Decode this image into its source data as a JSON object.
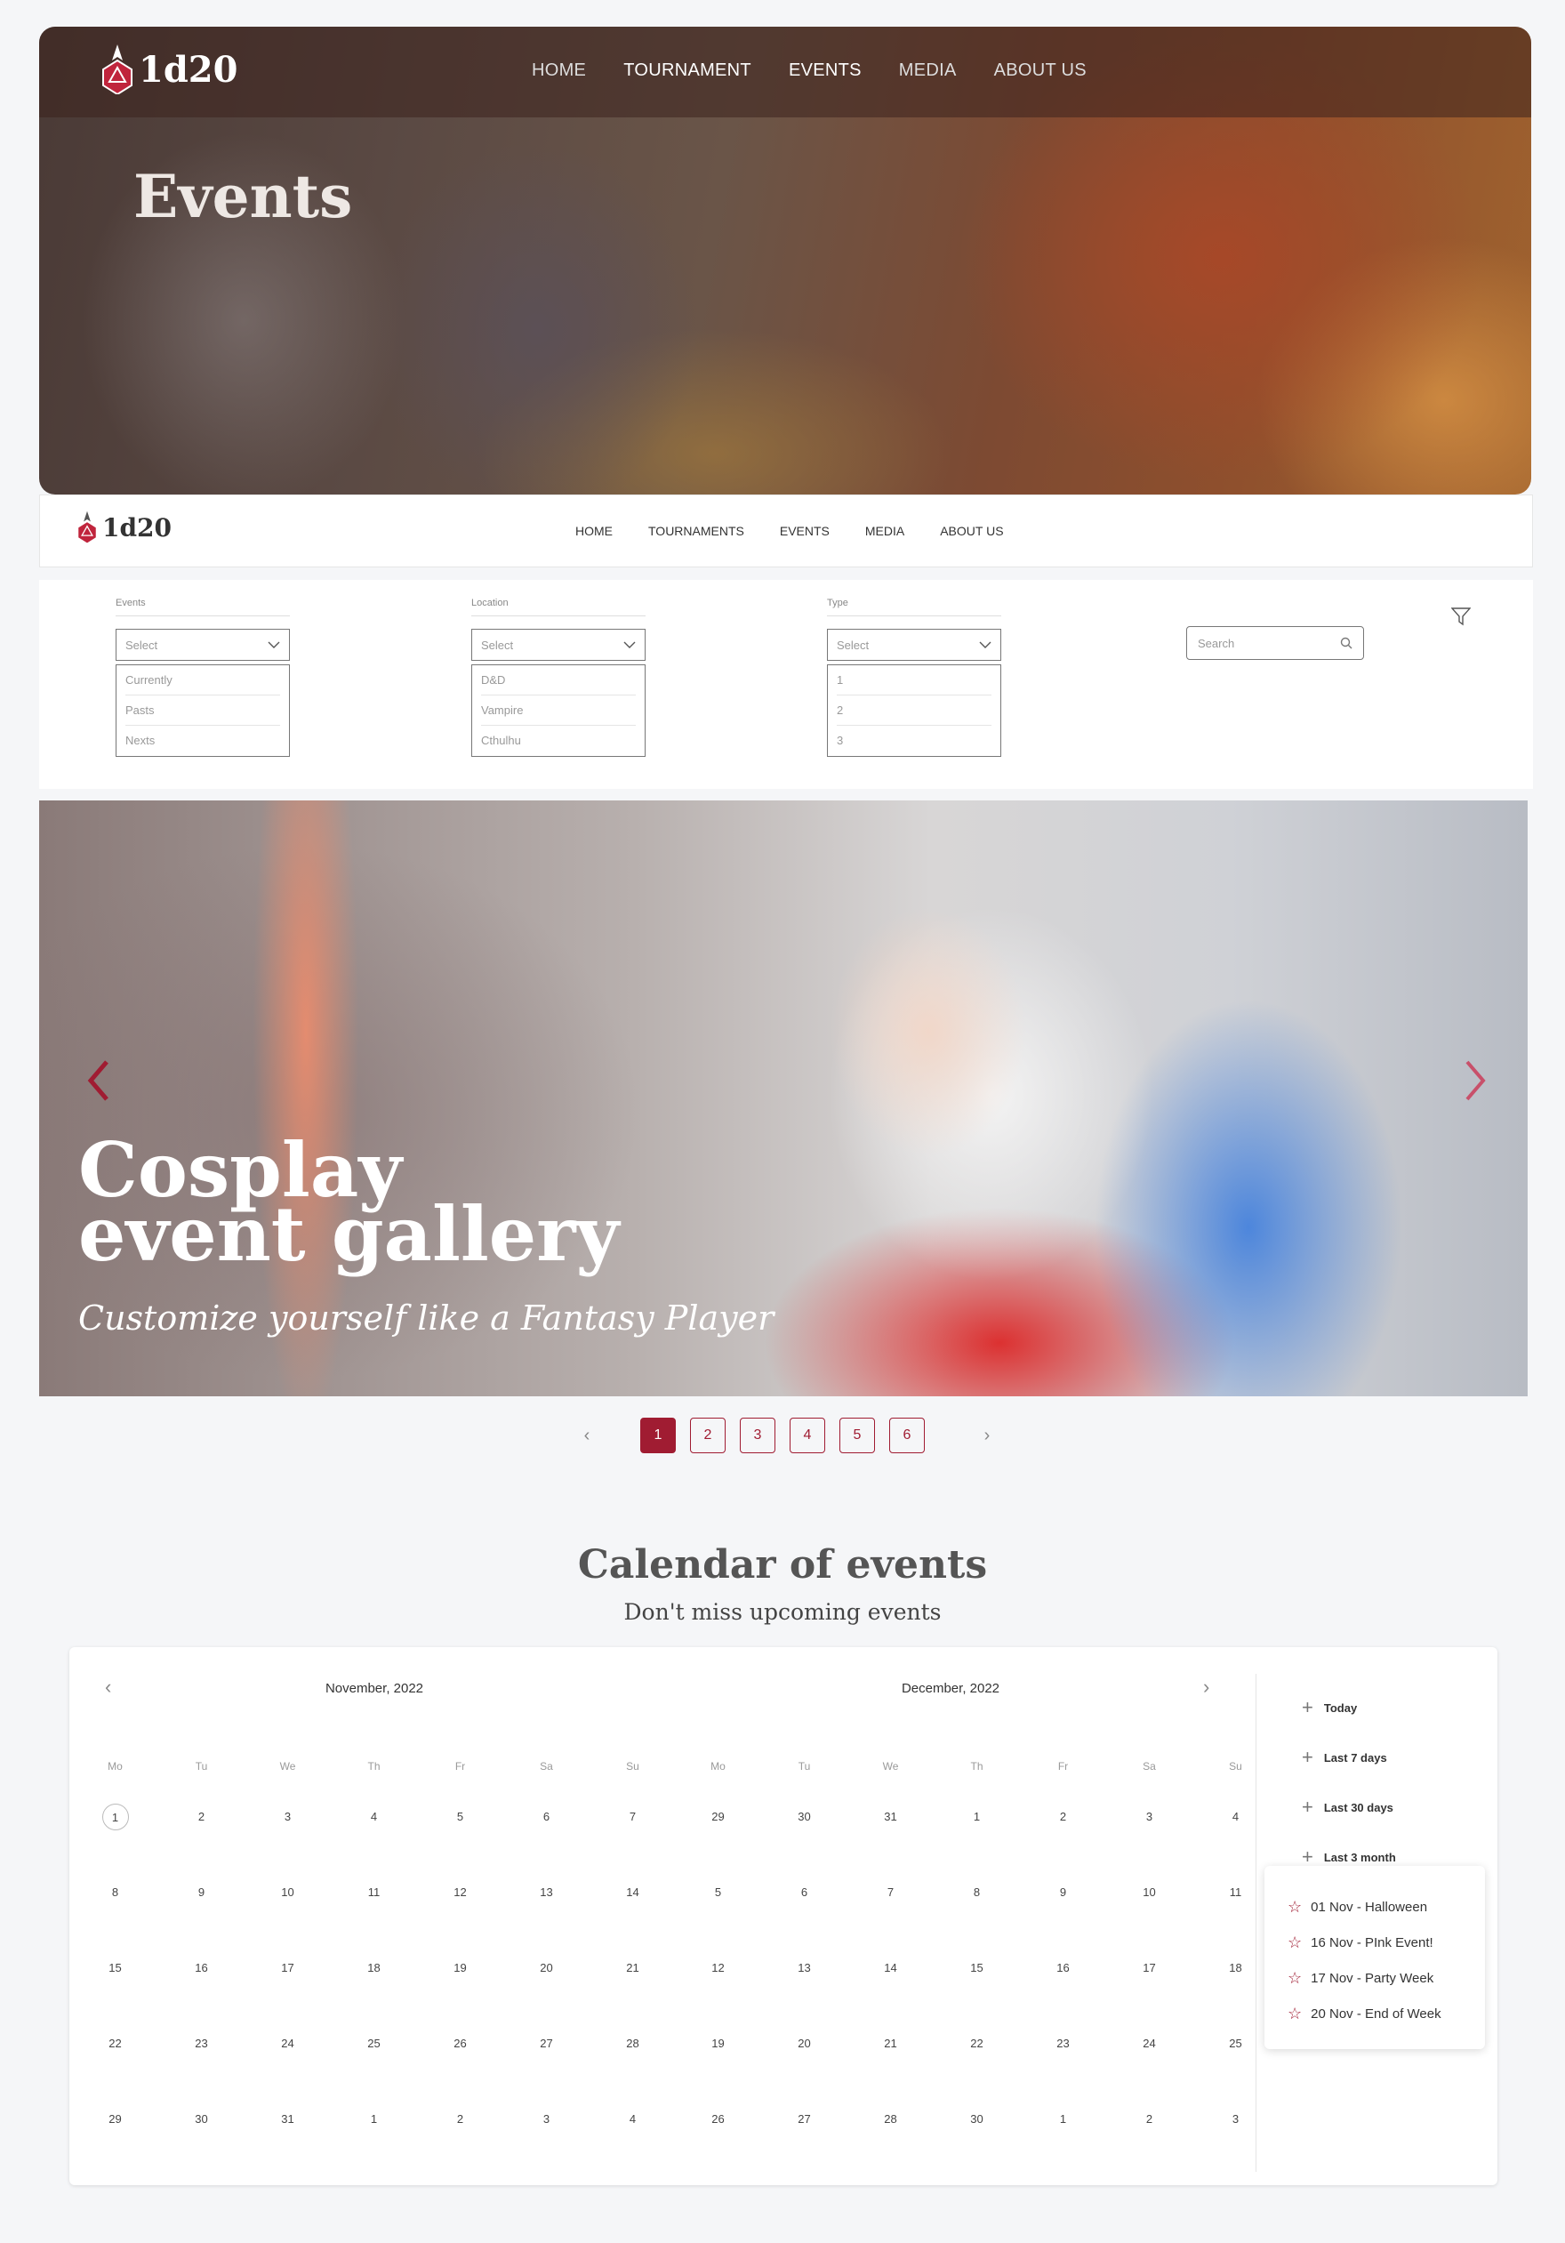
{
  "brand": {
    "name": "1d20",
    "accent": "#a01c32"
  },
  "hero": {
    "nav": [
      "HOME",
      "TOURNAMENT",
      "EVENTS",
      "MEDIA",
      "ABOUT US"
    ],
    "title": "Events"
  },
  "subnav": {
    "items": [
      "HOME",
      "TOURNAMENTS",
      "EVENTS",
      "MEDIA",
      "ABOUT US"
    ]
  },
  "filters": {
    "groups": [
      {
        "label": "Events",
        "value": "Select",
        "options": [
          "Currently",
          "Pasts",
          "Nexts"
        ]
      },
      {
        "label": "Location",
        "value": "Select",
        "options": [
          "D&D",
          "Vampire",
          "Cthulhu"
        ]
      },
      {
        "label": "Type",
        "value": "Select",
        "options": [
          "1",
          "2",
          "3"
        ]
      }
    ],
    "search_placeholder": "Search",
    "icons": {
      "search": "search-icon",
      "filter": "filter-icon",
      "dropdown": "chevron-down-icon"
    }
  },
  "gallery": {
    "title_line1": "Cosplay",
    "title_line2": "event gallery",
    "subtitle": "Customize yourself like a Fantasy Player"
  },
  "pagination": {
    "pages": [
      "1",
      "2",
      "3",
      "4",
      "5",
      "6"
    ],
    "active": "1"
  },
  "calendar": {
    "title": "Calendar of events",
    "subtitle": "Don't miss upcoming events",
    "weekdays": [
      "Mo",
      "Tu",
      "We",
      "Th",
      "Fr",
      "Sa",
      "Su"
    ],
    "months": [
      {
        "title": "November, 2022",
        "weeks": [
          [
            "1",
            "2",
            "3",
            "4",
            "5",
            "6",
            "7"
          ],
          [
            "8",
            "9",
            "10",
            "11",
            "12",
            "13",
            "14"
          ],
          [
            "15",
            "16",
            "17",
            "18",
            "19",
            "20",
            "21"
          ],
          [
            "22",
            "23",
            "24",
            "25",
            "26",
            "27",
            "28"
          ],
          [
            "29",
            "30",
            "31",
            "1",
            "2",
            "3",
            "4"
          ]
        ],
        "circled": "1"
      },
      {
        "title": "December, 2022",
        "weeks": [
          [
            "29",
            "30",
            "31",
            "1",
            "2",
            "3",
            "4"
          ],
          [
            "5",
            "6",
            "7",
            "8",
            "9",
            "10",
            "11"
          ],
          [
            "12",
            "13",
            "14",
            "15",
            "16",
            "17",
            "18"
          ],
          [
            "19",
            "20",
            "21",
            "22",
            "23",
            "24",
            "25"
          ],
          [
            "26",
            "27",
            "28",
            "30",
            "1",
            "2",
            "3"
          ]
        ]
      }
    ],
    "ranges": [
      "Today",
      "Last 7 days",
      "Last 30 days",
      "Last 3 month"
    ],
    "events": [
      "01 Nov - Halloween",
      "16 Nov -  PInk Event!",
      "17 Nov - Party Week",
      "20 Nov - End of Week"
    ]
  }
}
